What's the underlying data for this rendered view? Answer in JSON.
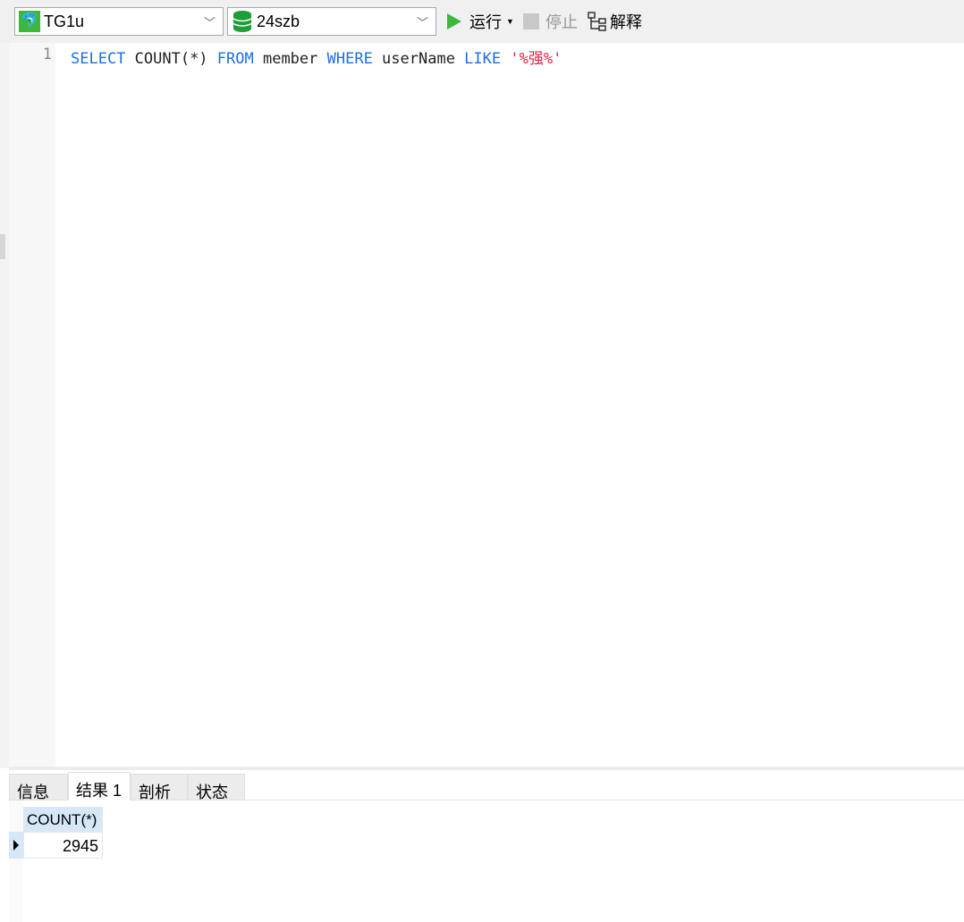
{
  "toolbar": {
    "connection": "TG1u",
    "database": "24szb",
    "run_label": "运行",
    "stop_label": "停止",
    "explain_label": "解释"
  },
  "editor": {
    "line_number": "1",
    "tokens": [
      "SELECT",
      " COUNT(*) ",
      "FROM",
      " member ",
      "WHERE",
      " userName ",
      "LIKE",
      " ",
      "'%强%'"
    ]
  },
  "results": {
    "tabs": [
      "信息",
      "结果 1",
      "剖析",
      "状态"
    ],
    "active_tab": "结果 1",
    "columns": [
      "COUNT(*)"
    ],
    "rows": [
      [
        "2945"
      ]
    ]
  },
  "colors": {
    "keyword": "#1e6fe0",
    "string": "#e8204a",
    "run_green": "#3cb93c"
  }
}
